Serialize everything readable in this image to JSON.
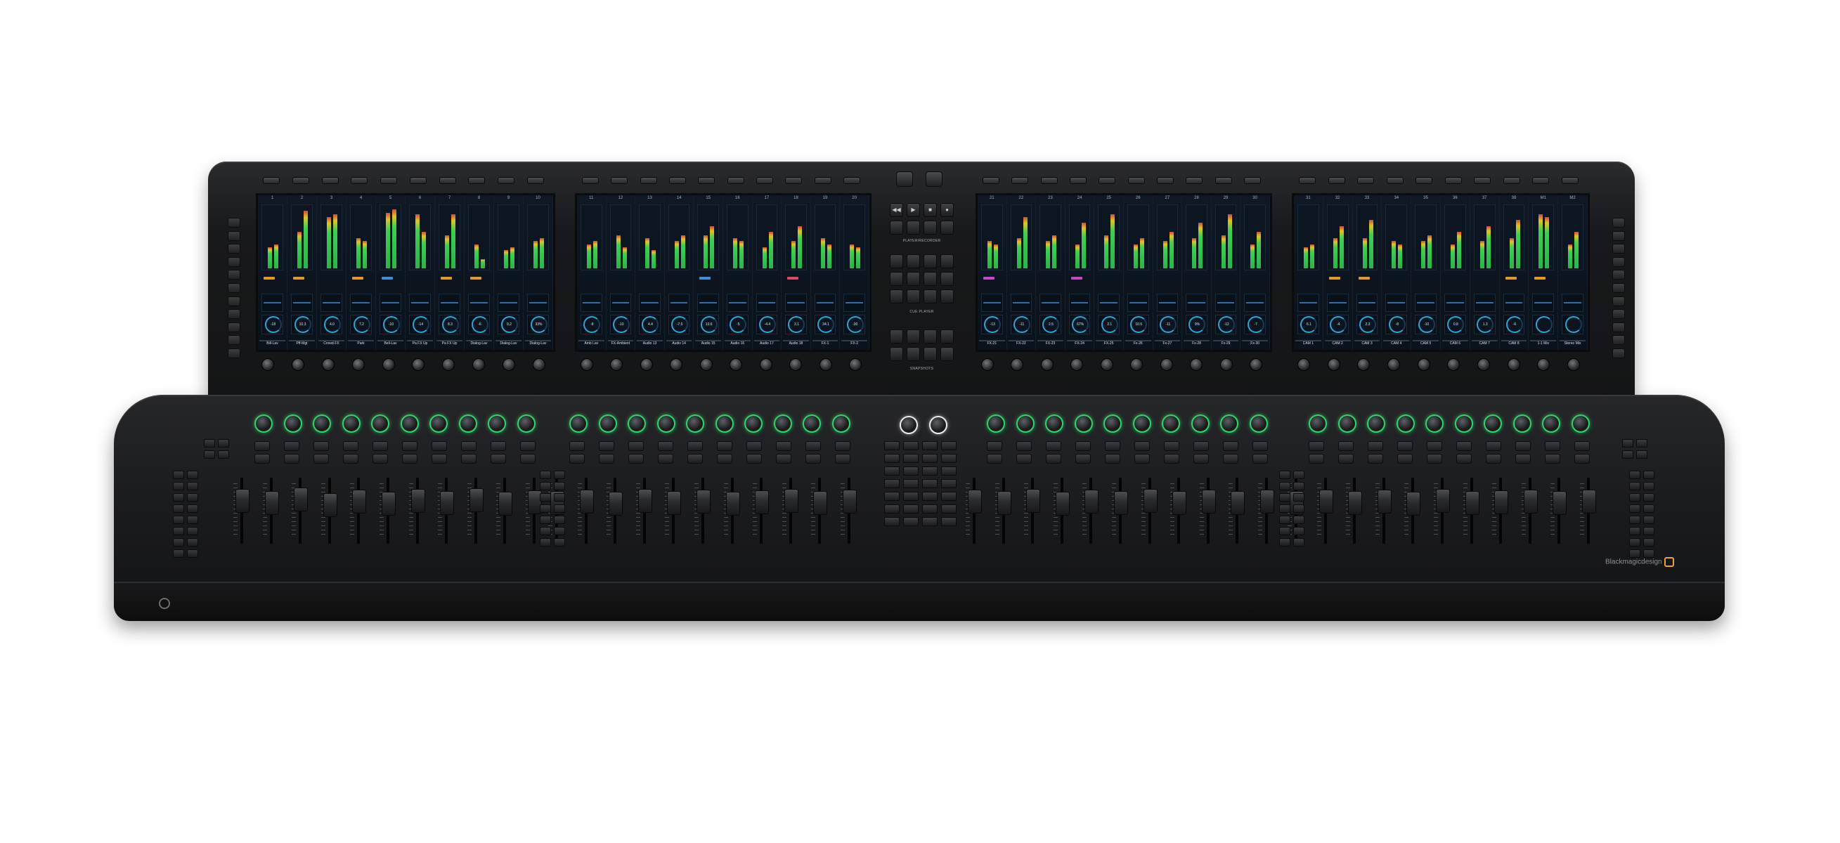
{
  "product": {
    "brand_text": "Blackmagicdesign",
    "accent_color": "#e6a23c",
    "encoder_ring_color": "#33d36b",
    "meter_green": "#3fcf55"
  },
  "bridge": {
    "center_labels": {
      "player_recorder": "PLAYER/RECORDER",
      "cue_player": "CUE PLAYER",
      "snapshots": "SNAPSHOTS"
    },
    "transport_icons": [
      "rewind-icon",
      "play-icon",
      "stop-icon",
      "record-icon"
    ]
  },
  "screens": [
    {
      "strips": [
        {
          "num": "1",
          "name": "Bill-Lav",
          "val": "-18",
          "l": 0.35,
          "r": 0.4,
          "tag": "#e39a24"
        },
        {
          "num": "2",
          "name": "Pff-Mgt",
          "val": "10.3",
          "l": 0.6,
          "r": 0.95,
          "tag": "#e39a24"
        },
        {
          "num": "3",
          "name": "Crowd-FX",
          "val": "4.0",
          "l": 0.85,
          "r": 0.9,
          "tag": ""
        },
        {
          "num": "4",
          "name": "Park",
          "val": "7.2",
          "l": 0.5,
          "r": 0.45,
          "tag": "#e39a24"
        },
        {
          "num": "5",
          "name": "Bell-Lav",
          "val": "-10",
          "l": 0.92,
          "r": 0.98,
          "tag": "#3c8fd6"
        },
        {
          "num": "6",
          "name": "Pa FX Up",
          "val": "-14",
          "l": 0.9,
          "r": 0.6,
          "tag": ""
        },
        {
          "num": "7",
          "name": "Pa FX Up",
          "val": "8.3",
          "l": 0.55,
          "r": 0.9,
          "tag": "#e39a24"
        },
        {
          "num": "8",
          "name": "Dialog-Lav",
          "val": "-6",
          "l": 0.4,
          "r": 0.15,
          "tag": "#e39a24"
        },
        {
          "num": "9",
          "name": "Dialog-Lav",
          "val": "9.2",
          "l": 0.3,
          "r": 0.35,
          "tag": ""
        },
        {
          "num": "10",
          "name": "Dialog-Lav",
          "val": "33%",
          "l": 0.45,
          "r": 0.5,
          "tag": ""
        }
      ]
    },
    {
      "strips": [
        {
          "num": "11",
          "name": "Amb Lav",
          "val": "-8",
          "l": 0.4,
          "r": 0.45,
          "tag": ""
        },
        {
          "num": "12",
          "name": "FX-Ambient",
          "val": "-10",
          "l": 0.55,
          "r": 0.35,
          "tag": ""
        },
        {
          "num": "13",
          "name": "Audio 13",
          "val": "4.4",
          "l": 0.5,
          "r": 0.3,
          "tag": ""
        },
        {
          "num": "14",
          "name": "Audio 14",
          "val": "-7.5",
          "l": 0.45,
          "r": 0.55,
          "tag": ""
        },
        {
          "num": "15",
          "name": "Audio 15",
          "val": "10.6",
          "l": 0.55,
          "r": 0.7,
          "tag": "#3c8fd6"
        },
        {
          "num": "16",
          "name": "Audio 16",
          "val": "-5",
          "l": 0.5,
          "r": 0.45,
          "tag": ""
        },
        {
          "num": "17",
          "name": "Audio 17",
          "val": "-4.4",
          "l": 0.35,
          "r": 0.6,
          "tag": ""
        },
        {
          "num": "18",
          "name": "Audio 18",
          "val": "3.1",
          "l": 0.45,
          "r": 0.7,
          "tag": "#e0476a"
        },
        {
          "num": "19",
          "name": "FX-1",
          "val": "34.1",
          "l": 0.5,
          "r": 0.4,
          "tag": ""
        },
        {
          "num": "20",
          "name": "FX-2",
          "val": "-30",
          "l": 0.4,
          "r": 0.35,
          "tag": ""
        }
      ]
    },
    {
      "strips": [
        {
          "num": "21",
          "name": "FX-21",
          "val": "-13",
          "l": 0.45,
          "r": 0.4,
          "tag": "#c548c8"
        },
        {
          "num": "22",
          "name": "FX-22",
          "val": "-11",
          "l": 0.5,
          "r": 0.85,
          "tag": ""
        },
        {
          "num": "23",
          "name": "FX-23",
          "val": "2.5",
          "l": 0.45,
          "r": 0.55,
          "tag": ""
        },
        {
          "num": "24",
          "name": "FX-24",
          "val": "67%",
          "l": 0.4,
          "r": 0.75,
          "tag": "#c548c8"
        },
        {
          "num": "25",
          "name": "FX-25",
          "val": "2.1",
          "l": 0.55,
          "r": 0.9,
          "tag": ""
        },
        {
          "num": "26",
          "name": "Fx-26",
          "val": "10.5",
          "l": 0.4,
          "r": 0.5,
          "tag": ""
        },
        {
          "num": "27",
          "name": "Fx-27",
          "val": "-11",
          "l": 0.45,
          "r": 0.6,
          "tag": ""
        },
        {
          "num": "28",
          "name": "Fx-28",
          "val": "9%",
          "l": 0.5,
          "r": 0.75,
          "tag": ""
        },
        {
          "num": "29",
          "name": "Fx-29",
          "val": "-12",
          "l": 0.55,
          "r": 0.9,
          "tag": ""
        },
        {
          "num": "30",
          "name": "Fx-30",
          "val": "-7",
          "l": 0.4,
          "r": 0.6,
          "tag": ""
        }
      ]
    },
    {
      "strips": [
        {
          "num": "31",
          "name": "CAM 1",
          "val": "6.1",
          "l": 0.35,
          "r": 0.4,
          "tag": ""
        },
        {
          "num": "32",
          "name": "CAM 2",
          "val": "-4",
          "l": 0.5,
          "r": 0.7,
          "tag": "#e39a24"
        },
        {
          "num": "33",
          "name": "CAM 3",
          "val": "2.3",
          "l": 0.5,
          "r": 0.8,
          "tag": "#e39a24"
        },
        {
          "num": "34",
          "name": "CAM 4",
          "val": "-8",
          "l": 0.45,
          "r": 0.4,
          "tag": ""
        },
        {
          "num": "35",
          "name": "CAM 5",
          "val": "-10",
          "l": 0.45,
          "r": 0.55,
          "tag": ""
        },
        {
          "num": "36",
          "name": "CAM 6",
          "val": "0.8",
          "l": 0.4,
          "r": 0.6,
          "tag": ""
        },
        {
          "num": "37",
          "name": "CAM 7",
          "val": "1.3",
          "l": 0.45,
          "r": 0.7,
          "tag": ""
        },
        {
          "num": "38",
          "name": "CAM 8",
          "val": "-6",
          "l": 0.5,
          "r": 0.8,
          "tag": "#e39a24"
        },
        {
          "num": "M1",
          "name": "1-1 Mix",
          "val": "",
          "l": 0.9,
          "r": 0.85,
          "tag": "#e39a24"
        },
        {
          "num": "M2",
          "name": "Stereo Mix",
          "val": "",
          "l": 0.4,
          "r": 0.6,
          "tag": ""
        }
      ]
    }
  ],
  "desk": {
    "fader_positions": [
      [
        0.25,
        0.3,
        0.22,
        0.35,
        0.28,
        0.32,
        0.26,
        0.3,
        0.24,
        0.33,
        0.29
      ],
      [
        0.3,
        0.28,
        0.32,
        0.25,
        0.3,
        0.27,
        0.33,
        0.29,
        0.26,
        0.31,
        0.28
      ],
      [
        0.28,
        0.3,
        0.26,
        0.32,
        0.27,
        0.3,
        0.25,
        0.31,
        0.28,
        0.3,
        0.27
      ],
      [
        0.3,
        0.27,
        0.31,
        0.28,
        0.33,
        0.26,
        0.3,
        0.29,
        0.27,
        0.31,
        0.28
      ]
    ]
  }
}
